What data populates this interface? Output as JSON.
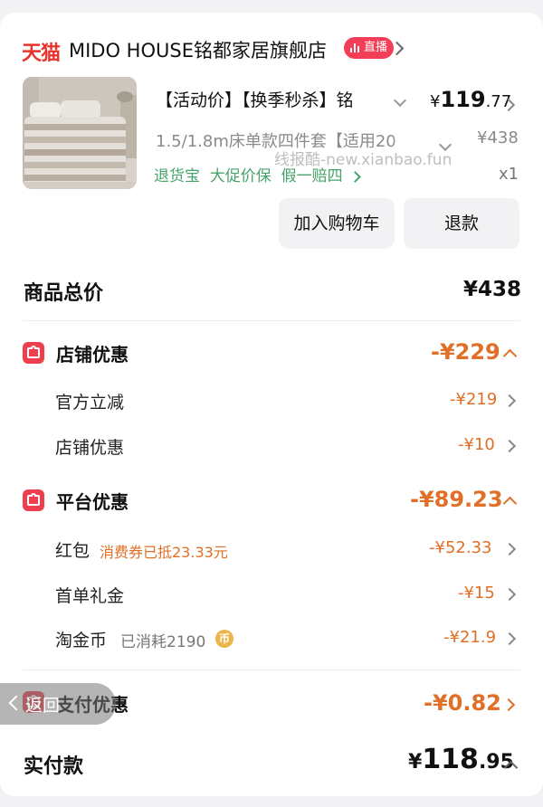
{
  "store": {
    "platform_logo": "天猫",
    "name": "MIDO HOUSE铭都家居旗舰店",
    "live_badge": "直播"
  },
  "product": {
    "title": "【活动价】【换季秒杀】铭",
    "price_yen": "¥",
    "price_int": "119",
    "price_dec": ".77",
    "sku": "1.5/1.8m床单款四件套【适用20",
    "original_price": "¥438",
    "tags": "退货宝  大促价保  假一赔四",
    "quantity": "x1",
    "watermark": "线报酷-new.xianbao.fun"
  },
  "actions": {
    "add_to_cart": "加入购物车",
    "refund": "退款"
  },
  "summary": {
    "goods_total_label": "商品总价",
    "goods_total_value": "¥438"
  },
  "store_discount": {
    "title": "店铺优惠",
    "amount": "-¥229",
    "items": [
      {
        "label": "官方立减",
        "amount": "-¥219"
      },
      {
        "label": "店铺优惠",
        "amount": "-¥10"
      }
    ]
  },
  "platform_discount": {
    "title": "平台优惠",
    "amount": "-¥89.23",
    "items": [
      {
        "label": "红包",
        "note": "消费券已抵23.33元",
        "amount": "-¥52.33"
      },
      {
        "label": "首单礼金",
        "amount": "-¥15"
      },
      {
        "label": "淘金币",
        "note": "已消耗2190",
        "coin_glyph": "币",
        "amount": "-¥21.9"
      }
    ]
  },
  "payment_discount": {
    "title": "支付优惠",
    "amount": "-¥0.82"
  },
  "back_button": {
    "label": "返回"
  },
  "paid": {
    "label": "实付款",
    "yen": "¥",
    "int": "118",
    "dec": ".95"
  },
  "colors": {
    "accent_orange": "#e06f27",
    "tmall_red": "#e8332e",
    "live_pink": "#f43e57",
    "tag_green": "#47a36b",
    "section_icon_red": "#ee3f4e"
  },
  "icons": {
    "store_discount": "shop-coupon-icon",
    "platform_discount": "platform-coupon-icon",
    "payment_discount": "payment-coupon-icon",
    "coin": "taojinbi-coin-icon",
    "live": "live-bars-icon"
  }
}
